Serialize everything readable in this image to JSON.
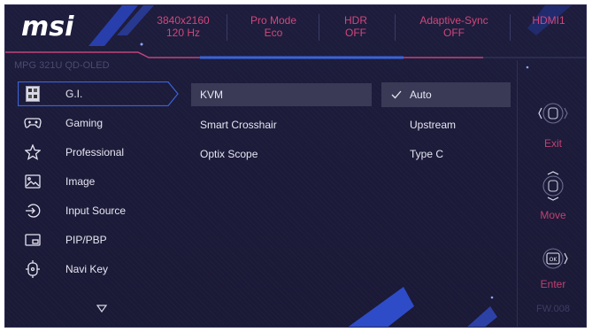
{
  "header": {
    "logo": "msi",
    "items": [
      {
        "line1": "3840x2160",
        "line2": "120 Hz"
      },
      {
        "line1": "Pro Mode",
        "line2": "Eco"
      },
      {
        "line1": "HDR",
        "line2": "OFF"
      },
      {
        "line1": "Adaptive-Sync",
        "line2": "OFF"
      },
      {
        "line1": "HDMI1",
        "line2": ""
      }
    ],
    "model": "MPG 321U QD-OLED"
  },
  "sidebar": {
    "items": [
      {
        "label": "G.I.",
        "icon": "gi-icon",
        "active": true
      },
      {
        "label": "Gaming",
        "icon": "gamepad-icon"
      },
      {
        "label": "Professional",
        "icon": "star-icon"
      },
      {
        "label": "Image",
        "icon": "image-icon"
      },
      {
        "label": "Input Source",
        "icon": "input-source-icon"
      },
      {
        "label": "PIP/PBP",
        "icon": "pip-icon"
      },
      {
        "label": "Navi Key",
        "icon": "navi-key-icon"
      }
    ]
  },
  "submenu": {
    "items": [
      {
        "label": "KVM",
        "selected": true
      },
      {
        "label": "Smart Crosshair"
      },
      {
        "label": "Optix Scope"
      }
    ]
  },
  "options": {
    "items": [
      {
        "label": "Auto",
        "checked": true
      },
      {
        "label": "Upstream"
      },
      {
        "label": "Type C"
      }
    ]
  },
  "keys": {
    "exit": "Exit",
    "move": "Move",
    "enter": "Enter",
    "enter_icon_text": "OK",
    "firmware": "FW.008"
  },
  "colors": {
    "background": "#1b1a38",
    "accent_pink": "#d2477a",
    "accent_blue": "#3a63d8",
    "selection": "#3a3a56",
    "text": "#e6e6f2"
  }
}
